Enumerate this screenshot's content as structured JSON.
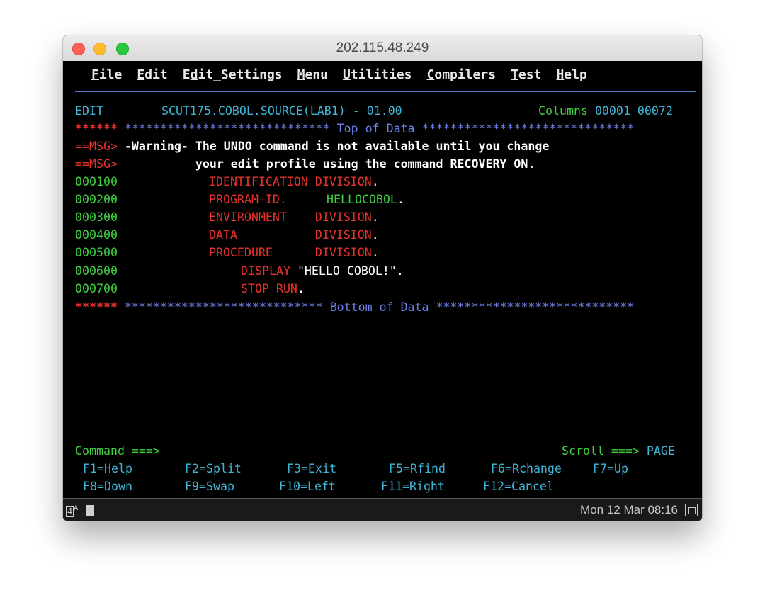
{
  "window": {
    "title": "202.115.48.249"
  },
  "menu": [
    {
      "key": "F",
      "rest": "ile"
    },
    {
      "key": "E",
      "rest": "dit"
    },
    {
      "key": "Ed",
      "rest": "it_Settings",
      "ul_index": 1
    },
    {
      "key": "M",
      "rest": "enu"
    },
    {
      "key": "U",
      "rest": "tilities"
    },
    {
      "key": "C",
      "rest": "ompilers"
    },
    {
      "key": "T",
      "rest": "est"
    },
    {
      "key": "H",
      "rest": "elp"
    }
  ],
  "menu_labels": {
    "file_u": "F",
    "file_r": "ile",
    "edit_u": "E",
    "edit_r": "dit",
    "eset_a": "E",
    "eset_u": "d",
    "eset_r": "it_Settings",
    "menu_u": "M",
    "menu_r": "enu",
    "util_u": "U",
    "util_r": "tilities",
    "comp_u": "C",
    "comp_r": "ompilers",
    "test_u": "T",
    "test_r": "est",
    "help_u": "H",
    "help_r": "elp"
  },
  "header": {
    "mode": "EDIT",
    "dataset": "SCUT175.COBOL.SOURCE(LAB1) - 01.00",
    "columns_label": "Columns",
    "col_start": "00001",
    "col_end": "00072"
  },
  "top_of_data": {
    "prefix": "******",
    "text": " ***************************** Top of Data ******************************"
  },
  "messages": [
    {
      "prefix": "==MSG>",
      "text": " -Warning- The UNDO command is not available until you change"
    },
    {
      "prefix": "==MSG>",
      "text": "           your edit profile using the command RECOVERY ON."
    }
  ],
  "lines": [
    {
      "num": "000100",
      "a": "IDENTIFICATION DIVISION",
      "dot": "."
    },
    {
      "num": "000200",
      "a": "PROGRAM-ID.",
      "b": "HELLOCOBOL",
      "dot": "."
    },
    {
      "num": "000300",
      "a": "ENVIRONMENT    DIVISION",
      "dot": "."
    },
    {
      "num": "000400",
      "a": "DATA           DIVISION",
      "dot": "."
    },
    {
      "num": "000500",
      "a": "PROCEDURE      DIVISION",
      "dot": "."
    },
    {
      "num": "000600",
      "a": "DISPLAY",
      "b": "\"HELLO COBOL!\"",
      "dot": "."
    },
    {
      "num": "000700",
      "a": "STOP RUN",
      "dot": "."
    }
  ],
  "bottom_of_data": {
    "prefix": "******",
    "text": " **************************** Bottom of Data ****************************"
  },
  "command": {
    "label": "Command ===>",
    "value": "",
    "scroll_label": "Scroll ===>",
    "scroll_value": "PAGE"
  },
  "fkeys_row1": [
    "F1=Help",
    "F2=Split",
    "F3=Exit",
    "F5=Rfind",
    "F6=Rchange",
    "F7=Up"
  ],
  "fkeys_row2": [
    "F8=Down",
    "F9=Swap",
    "F10=Left",
    "F11=Right",
    "F12=Cancel"
  ],
  "status": {
    "left_indicator": "4",
    "left_glyph": "A",
    "clock": "Mon 12 Mar 08:16"
  }
}
